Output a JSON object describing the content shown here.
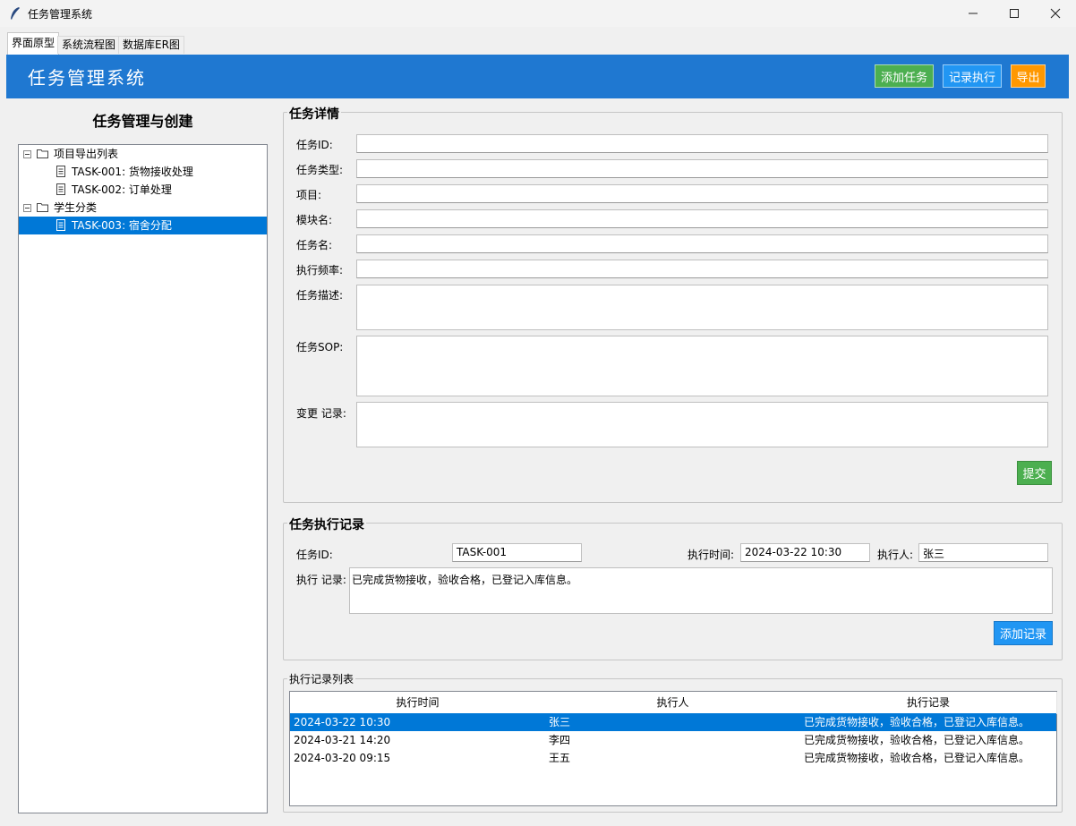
{
  "window": {
    "title": "任务管理系统",
    "minimize_icon": "minimize-icon",
    "maximize_icon": "maximize-icon",
    "close_icon": "close-icon"
  },
  "tabs": [
    {
      "label": "界面原型",
      "active": true
    },
    {
      "label": "系统流程图",
      "active": false
    },
    {
      "label": "数据库ER图",
      "active": false
    }
  ],
  "header": {
    "title": "任务管理系统",
    "background": "#1f78d1",
    "buttons": [
      {
        "label": "添加任务",
        "color": "#4caf50"
      },
      {
        "label": "记录执行",
        "color": "#2196f3"
      },
      {
        "label": "导出",
        "color": "#ff9800"
      }
    ]
  },
  "left": {
    "title": "任务管理与创建",
    "tree": [
      {
        "type": "folder",
        "label": "项目导出列表",
        "selected": false
      },
      {
        "type": "task",
        "label": "TASK-001: 货物接收处理",
        "selected": false
      },
      {
        "type": "task",
        "label": "TASK-002: 订单处理",
        "selected": false
      },
      {
        "type": "folder",
        "label": "学生分类",
        "selected": false
      },
      {
        "type": "task",
        "label": "TASK-003: 宿舍分配",
        "selected": true
      }
    ]
  },
  "detail": {
    "title": "任务详情",
    "fields": [
      {
        "label": "任务ID:",
        "value": ""
      },
      {
        "label": "任务类型:",
        "value": ""
      },
      {
        "label": "项目:",
        "value": ""
      },
      {
        "label": "模块名:",
        "value": ""
      },
      {
        "label": "任务名:",
        "value": ""
      },
      {
        "label": "执行频率:",
        "value": ""
      },
      {
        "label": "任务描述:",
        "value": ""
      },
      {
        "label": "任务SOP:",
        "value": ""
      },
      {
        "label": "变更 记录:",
        "value": ""
      }
    ],
    "submit_label": "提交"
  },
  "exec": {
    "title": "任务执行记录",
    "task_id_label": "任务ID:",
    "task_id_value": "TASK-001",
    "time_label": "执行时间:",
    "time_value": "2024-03-22 10:30",
    "person_label": "执行人:",
    "person_value": "张三",
    "record_label": "执行 记录:",
    "record_value": "已完成货物接收，验收合格，已登记入库信息。",
    "add_label": "添加记录"
  },
  "records": {
    "title": "执行记录列表",
    "columns": [
      "执行时间",
      "执行人",
      "执行记录"
    ],
    "rows": [
      {
        "time": "2024-03-22 10:30",
        "person": "张三",
        "record": "已完成货物接收，验收合格，已登记入库信息。",
        "selected": true
      },
      {
        "time": "2024-03-21 14:20",
        "person": "李四",
        "record": "已完成货物接收，验收合格，已登记入库信息。",
        "selected": false
      },
      {
        "time": "2024-03-20 09:15",
        "person": "王五",
        "record": "已完成货物接收，验收合格，已登记入库信息。",
        "selected": false
      }
    ]
  }
}
